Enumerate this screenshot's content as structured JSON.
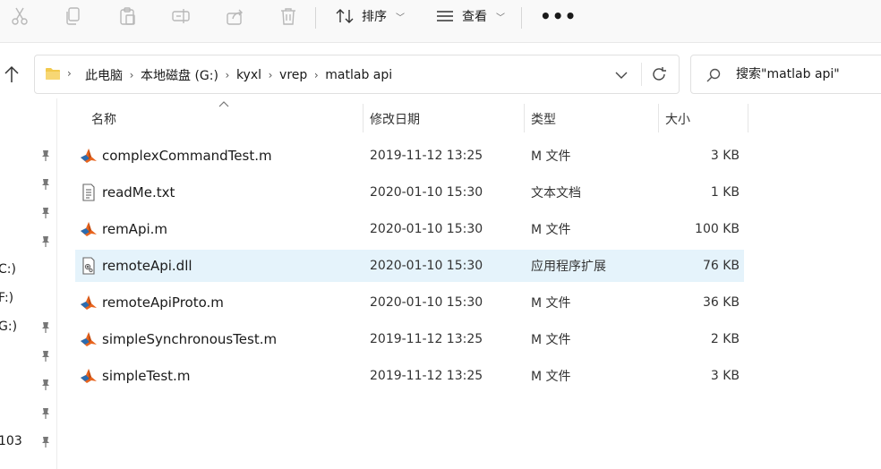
{
  "toolbar": {
    "sort_label": "排序",
    "view_label": "查看",
    "more_label": "•••"
  },
  "address": {
    "crumbs": [
      "此电脑",
      "本地磁盘 (G:)",
      "kyxl",
      "vrep",
      "matlab api"
    ]
  },
  "search": {
    "placeholder": "搜索\"matlab api\""
  },
  "nav": {
    "items": [
      {
        "label": ""
      },
      {
        "label": ""
      },
      {
        "label": ""
      },
      {
        "label": ""
      },
      {
        "label": "C:)"
      },
      {
        "label": "F:)"
      },
      {
        "label": "G:)"
      },
      {
        "label": ""
      },
      {
        "label": ""
      },
      {
        "label": ""
      },
      {
        "label": "103"
      }
    ]
  },
  "columns": {
    "name": "名称",
    "date": "修改日期",
    "type": "类型",
    "size": "大小"
  },
  "files": [
    {
      "name": "complexCommandTest.m",
      "date": "2019-11-12 13:25",
      "type": "M 文件",
      "size": "3 KB",
      "icon": "matlab-icon"
    },
    {
      "name": "readMe.txt",
      "date": "2020-01-10 15:30",
      "type": "文本文档",
      "size": "1 KB",
      "icon": "text-file-icon"
    },
    {
      "name": "remApi.m",
      "date": "2020-01-10 15:30",
      "type": "M 文件",
      "size": "100 KB",
      "icon": "matlab-icon"
    },
    {
      "name": "remoteApi.dll",
      "date": "2020-01-10 15:30",
      "type": "应用程序扩展",
      "size": "76 KB",
      "icon": "dll-file-icon"
    },
    {
      "name": "remoteApiProto.m",
      "date": "2020-01-10 15:30",
      "type": "M 文件",
      "size": "36 KB",
      "icon": "matlab-icon"
    },
    {
      "name": "simpleSynchronousTest.m",
      "date": "2019-11-12 13:25",
      "type": "M 文件",
      "size": "2 KB",
      "icon": "matlab-icon"
    },
    {
      "name": "simpleTest.m",
      "date": "2019-11-12 13:25",
      "type": "M 文件",
      "size": "3 KB",
      "icon": "matlab-icon"
    }
  ],
  "colors": {
    "selected_row": "#e5f3fb",
    "folder": "#f2c94c",
    "matlab_orange": "#e8641e",
    "matlab_blue": "#2b6cb0"
  }
}
